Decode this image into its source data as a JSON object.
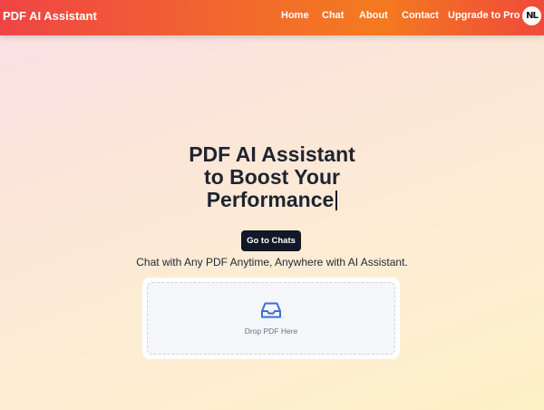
{
  "brand": {
    "title": "PDF AI Assistant"
  },
  "nav": {
    "links": [
      {
        "label": "Home"
      },
      {
        "label": "Chat"
      },
      {
        "label": "About"
      },
      {
        "label": "Contact"
      },
      {
        "label": "Upgrade to Pro"
      }
    ],
    "avatar_text": "NL"
  },
  "hero": {
    "title_lines": [
      "PDF AI Assistant",
      "to Boost Your",
      "Performance"
    ],
    "cta_label": "Go to Chats",
    "subtitle": "Chat with Any PDF Anytime, Anywhere with AI Assistant."
  },
  "dropzone": {
    "label": "Drop PDF Here",
    "icon": "inbox-tray-icon"
  },
  "colors": {
    "nav_gradient_start": "#ef4444",
    "nav_gradient_mid": "#f47a1f",
    "cta_bg": "#111827",
    "icon_blue": "#3b6fd8"
  }
}
